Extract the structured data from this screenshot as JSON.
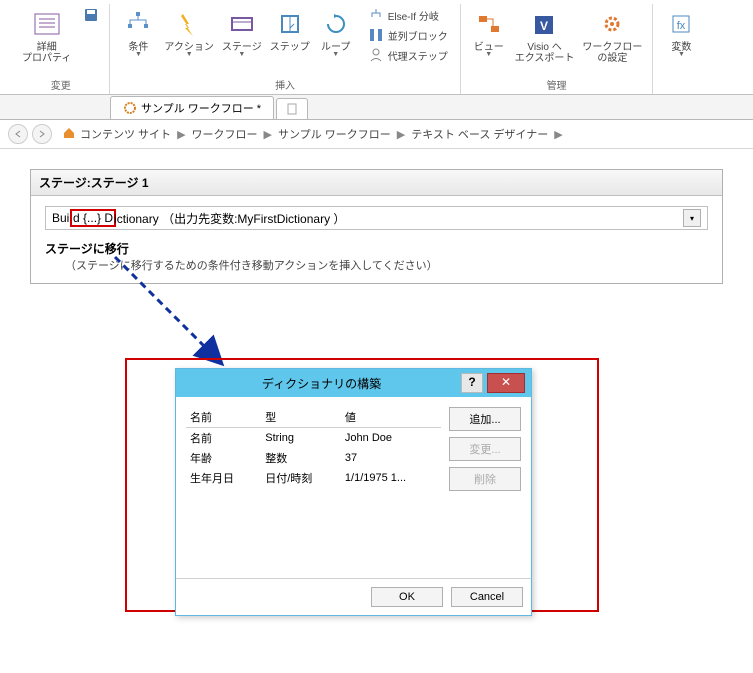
{
  "ribbon": {
    "group_change": "変更",
    "group_insert": "挿入",
    "group_manage": "管理",
    "detail_props": "詳細\nプロパティ",
    "save_small": "",
    "condition": "条件",
    "action": "アクション",
    "stage": "ステージ",
    "step": "ステップ",
    "loop": "ループ",
    "elseif": "Else-If 分岐",
    "parallel": "並列ブロック",
    "proxy": "代理ステップ",
    "view": "ビュー",
    "visio": "Visio へ\nエクスポート",
    "wfsettings": "ワークフロー\nの設定",
    "variables": "変数"
  },
  "tabs": {
    "tab1": "サンプル ワークフロー *"
  },
  "breadcrumb": {
    "b1": "コンテンツ サイト",
    "b2": "ワークフロー",
    "b3": "サンプル ワークフロー",
    "b4": "テキスト ベース デザイナー"
  },
  "stage": {
    "title": "ステージ:ステージ 1",
    "action_pre": "Buil",
    "action_brackets": "d {...} D",
    "action_post": "ictionary （出力先変数:MyFirstDictionary ）",
    "transition_label": "ステージに移行",
    "transition_hint": "（ステージに移行するための条件付き移動アクションを挿入してください）"
  },
  "dialog": {
    "title": "ディクショナリの構築",
    "col_name": "名前",
    "col_type": "型",
    "col_value": "値",
    "btn_add": "追加...",
    "btn_edit": "変更...",
    "btn_delete": "削除",
    "btn_ok": "OK",
    "btn_cancel": "Cancel",
    "rows": [
      {
        "name": "名前",
        "type": "String",
        "value": "John Doe"
      },
      {
        "name": "年齢",
        "type": "整数",
        "value": "37"
      },
      {
        "name": "生年月日",
        "type": "日付/時刻",
        "value": "1/1/1975 1..."
      }
    ]
  }
}
